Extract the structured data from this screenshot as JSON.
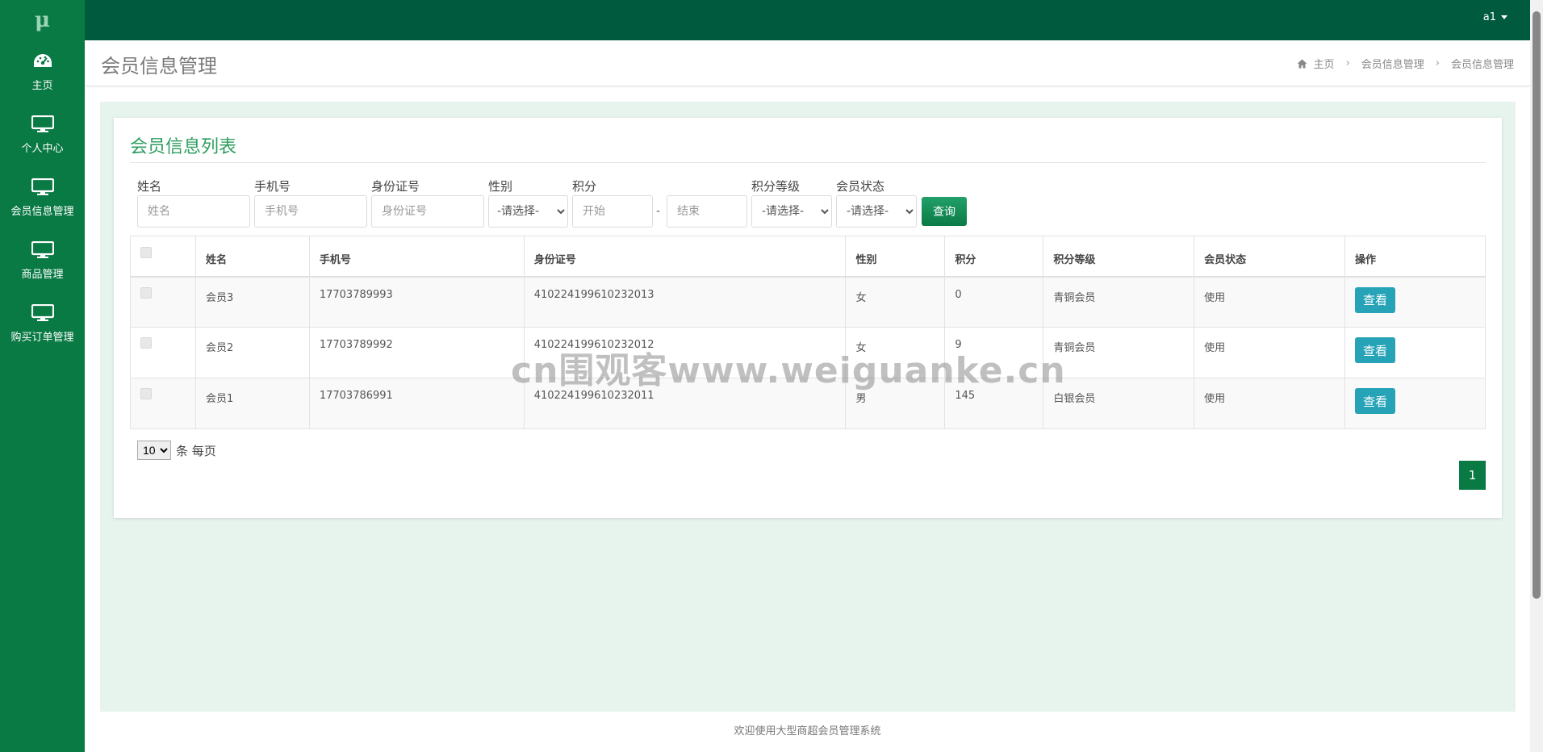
{
  "colors": {
    "sidebar": "#0a7a45",
    "topbar": "#005a3e",
    "accent": "#2d9d5f",
    "view_button": "#27a3b8"
  },
  "logo": "μ",
  "sidebar": {
    "items": [
      {
        "label": "主页",
        "icon": "dashboard-icon"
      },
      {
        "label": "个人中心",
        "icon": "monitor-icon"
      },
      {
        "label": "会员信息管理",
        "icon": "monitor-icon"
      },
      {
        "label": "商品管理",
        "icon": "monitor-icon"
      },
      {
        "label": "购买订单管理",
        "icon": "monitor-icon"
      }
    ]
  },
  "topbar": {
    "user": "a1"
  },
  "header": {
    "title": "会员信息管理",
    "breadcrumb": [
      "主页",
      "会员信息管理",
      "会员信息管理"
    ]
  },
  "card": {
    "title": "会员信息列表"
  },
  "filters": {
    "name": {
      "label": "姓名",
      "placeholder": "姓名"
    },
    "phone": {
      "label": "手机号",
      "placeholder": "手机号"
    },
    "idcard": {
      "label": "身份证号",
      "placeholder": "身份证号"
    },
    "gender": {
      "label": "性别",
      "selected": "-请选择-"
    },
    "points": {
      "label": "积分",
      "start_placeholder": "开始",
      "end_placeholder": "结束",
      "separator": "-"
    },
    "level": {
      "label": "积分等级",
      "selected": "-请选择-"
    },
    "status": {
      "label": "会员状态",
      "selected": "-请选择-"
    },
    "search_button": "查询"
  },
  "table": {
    "columns": [
      "姓名",
      "手机号",
      "身份证号",
      "性别",
      "积分",
      "积分等级",
      "会员状态",
      "操作"
    ],
    "rows": [
      {
        "name": "会员3",
        "phone": "17703789993",
        "idcard": "410224199610232013",
        "gender": "女",
        "points": "0",
        "level": "青铜会员",
        "status": "使用",
        "action": "查看"
      },
      {
        "name": "会员2",
        "phone": "17703789992",
        "idcard": "410224199610232012",
        "gender": "女",
        "points": "9",
        "level": "青铜会员",
        "status": "使用",
        "action": "查看"
      },
      {
        "name": "会员1",
        "phone": "17703786991",
        "idcard": "410224199610232011",
        "gender": "男",
        "points": "145",
        "level": "白银会员",
        "status": "使用",
        "action": "查看"
      }
    ]
  },
  "pagination": {
    "page_size": "10",
    "page_size_suffix": "条 每页",
    "current_page": "1"
  },
  "watermark": "cn围观客www.weiguanke.cn",
  "footer": "欢迎使用大型商超会员管理系统"
}
